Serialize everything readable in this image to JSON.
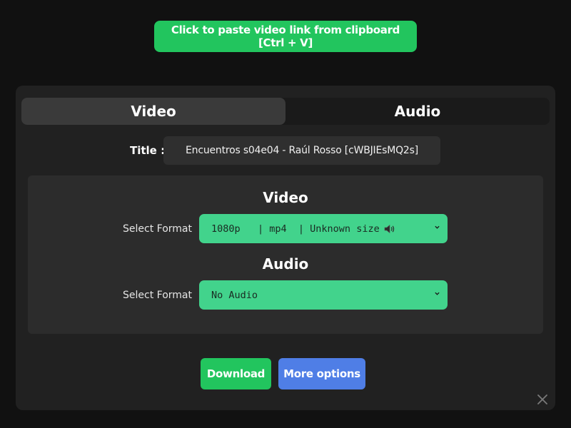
{
  "paste_button": {
    "label": "Click to paste video link from clipboard [Ctrl + V]"
  },
  "tabs": [
    {
      "label": "Video",
      "active": true
    },
    {
      "label": "Audio",
      "active": false
    }
  ],
  "title_field": {
    "label": "Title :",
    "value": "Encuentros s04e04 - Raúl Rosso [cWBJIEsMQ2s]"
  },
  "video_section": {
    "heading": "Video",
    "select_label": "Select Format",
    "selected": "1080p   | mp4  | Unknown size",
    "icon": "speaker-icon"
  },
  "audio_section": {
    "heading": "Audio",
    "select_label": "Select Format",
    "selected": "No Audio"
  },
  "actions": {
    "download_label": "Download",
    "more_options_label": "More options"
  },
  "colors": {
    "background": "#111111",
    "panel": "#212121",
    "green_button": "#22c55e",
    "select_green": "#42d38c",
    "blue_button": "#4f7ee6"
  }
}
